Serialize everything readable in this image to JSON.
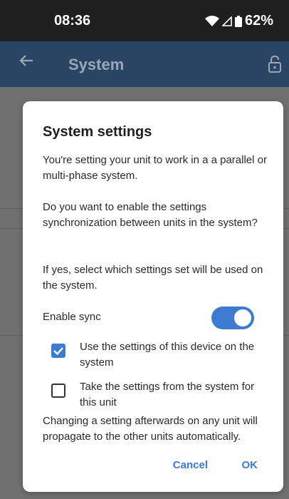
{
  "status": {
    "time": "08:36",
    "battery": "62%"
  },
  "appbar": {
    "title": "System",
    "back_icon": "back-arrow-icon",
    "lock_icon": "lock-icon"
  },
  "dialog": {
    "title": "System settings",
    "para1": "You're setting your unit to work in a a parallel or multi-phase system.",
    "para2": "Do you want to enable the settings synchronization between units in the system?",
    "para3": "If yes, select which settings set will be used on the system.",
    "sync_label": "Enable sync",
    "sync_enabled": true,
    "options": [
      {
        "label": "Use the settings of this device on the system",
        "checked": true
      },
      {
        "label": "Take the settings from the system for this unit",
        "checked": false
      }
    ],
    "note": "Changing a setting afterwards on any unit will propagate to the other units automatically.",
    "cancel_label": "Cancel",
    "ok_label": "OK"
  },
  "colors": {
    "accent": "#3c7bd0",
    "appbar": "#2a4463",
    "statusbar": "#1f1f1f"
  }
}
